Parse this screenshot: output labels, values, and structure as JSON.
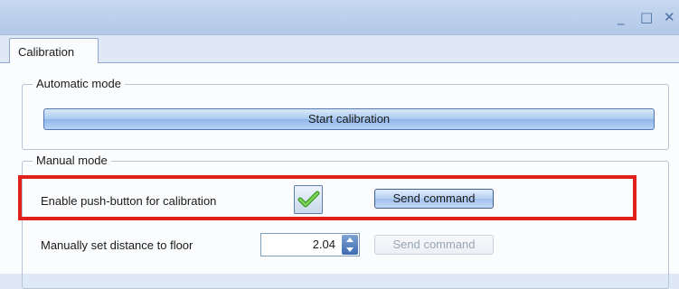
{
  "window": {
    "controls": {
      "minimize": "_",
      "maximize": "□",
      "close": "✕"
    }
  },
  "tabs": [
    {
      "label": "Calibration",
      "active": true
    }
  ],
  "automatic": {
    "title": "Automatic mode",
    "start_button": "Start calibration"
  },
  "manual": {
    "title": "Manual mode",
    "push_button_row": {
      "label": "Enable push-button for calibration",
      "checked": true,
      "checkbox_icon": "check-icon",
      "send_button": "Send command",
      "send_enabled": true
    },
    "distance_row": {
      "label": "Manually set distance to floor",
      "value": "2.04",
      "send_button": "Send command",
      "send_enabled": false
    }
  },
  "colors": {
    "highlight": "#e2201c",
    "check": "#5db83a",
    "accent": "#3d6bb0"
  }
}
